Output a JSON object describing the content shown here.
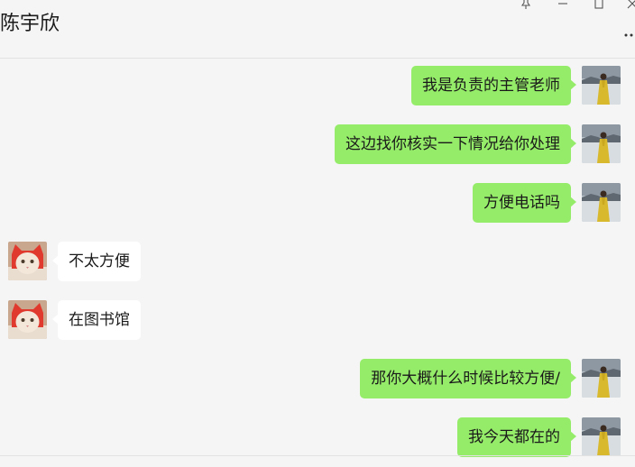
{
  "header": {
    "contact_name": "陈宇欣"
  },
  "messages": [
    {
      "side": "me",
      "text": "我是负责的主管老师"
    },
    {
      "side": "me",
      "text": "这边找你核实一下情况给你处理"
    },
    {
      "side": "me",
      "text": "方便电话吗"
    },
    {
      "side": "other",
      "text": "不太方便"
    },
    {
      "side": "other",
      "text": "在图书馆"
    },
    {
      "side": "me",
      "text": "那你大概什么时候比较方便/"
    },
    {
      "side": "me",
      "text": "我今天都在的"
    }
  ],
  "colors": {
    "my_bubble": "#95ec69",
    "other_bubble": "#ffffff",
    "background": "#f5f5f5"
  },
  "icons": [
    "pin-icon",
    "minimize-icon",
    "maximize-icon",
    "close-icon",
    "more-icon"
  ]
}
